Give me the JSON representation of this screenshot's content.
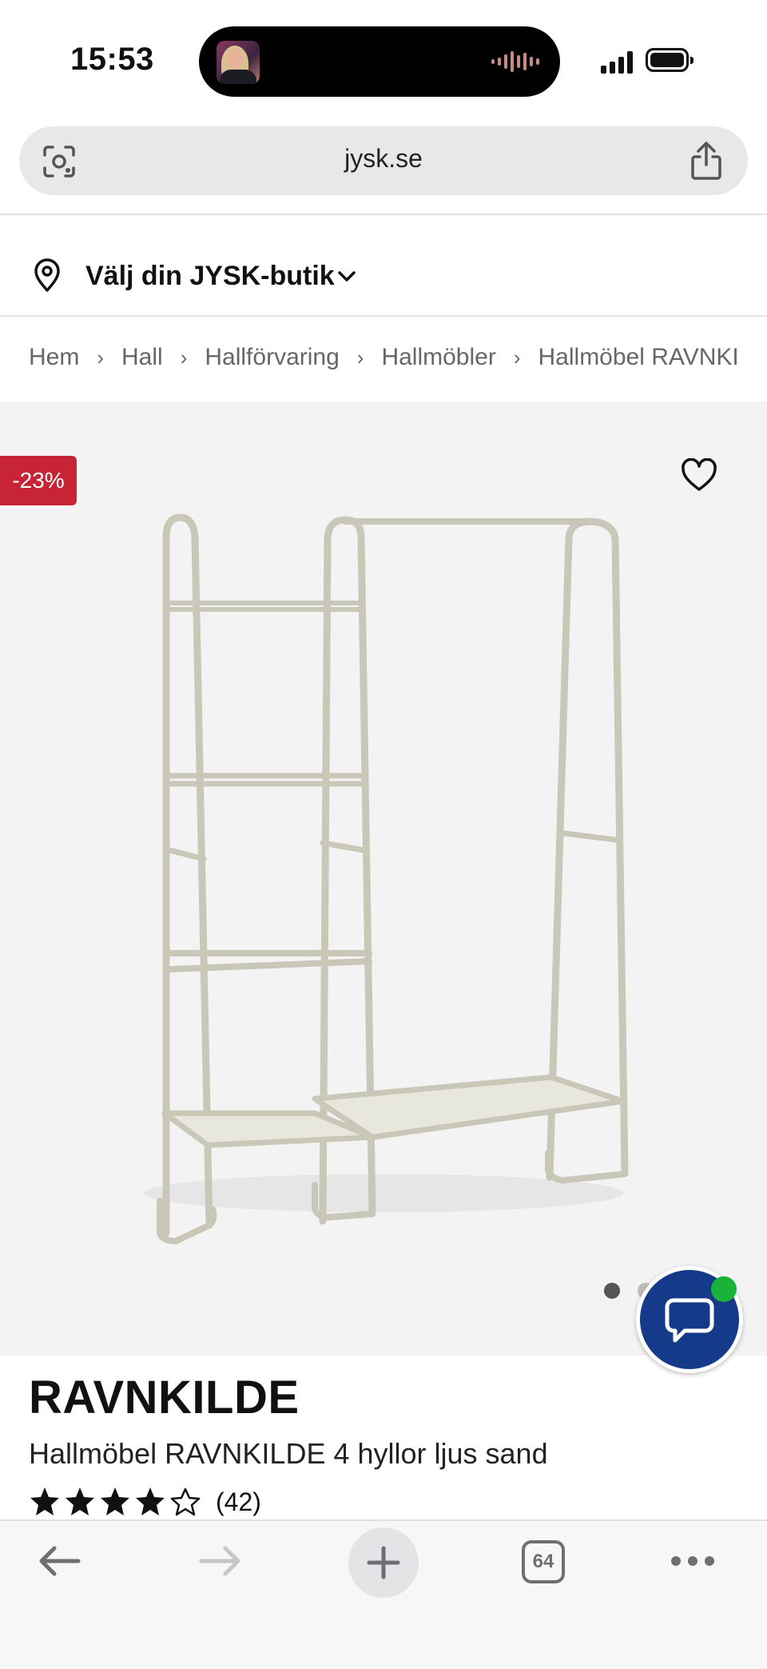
{
  "status_bar": {
    "time": "15:53"
  },
  "browser": {
    "url": "jysk.se",
    "open_tabs": "64"
  },
  "store_selector": {
    "label": "Välj din JYSK-butik"
  },
  "breadcrumb": [
    "Hem",
    "Hall",
    "Hallförvaring",
    "Hallmöbler",
    "Hallmöbel RAVNKI"
  ],
  "product": {
    "discount_badge": "-23%",
    "name": "RAVNKILDE",
    "description": "Hallmöbel RAVNKILDE 4 hyllor ljus sand",
    "rating": 4,
    "rating_max": 5,
    "review_count": "(42)",
    "image_count": 2,
    "image_index": 1
  },
  "colors": {
    "badge": "#c72535",
    "chat_button": "#153a8a",
    "online_indicator": "#18b338",
    "image_background": "#f3f3f4",
    "product_color": "#c9c7b7"
  },
  "icons": [
    "lens-icon",
    "share-icon",
    "location-pin-icon",
    "chevron-down-icon",
    "heart-icon",
    "chat-icon",
    "star-icon",
    "back-arrow-icon",
    "forward-arrow-icon",
    "plus-icon",
    "tabs-icon",
    "more-icon"
  ]
}
